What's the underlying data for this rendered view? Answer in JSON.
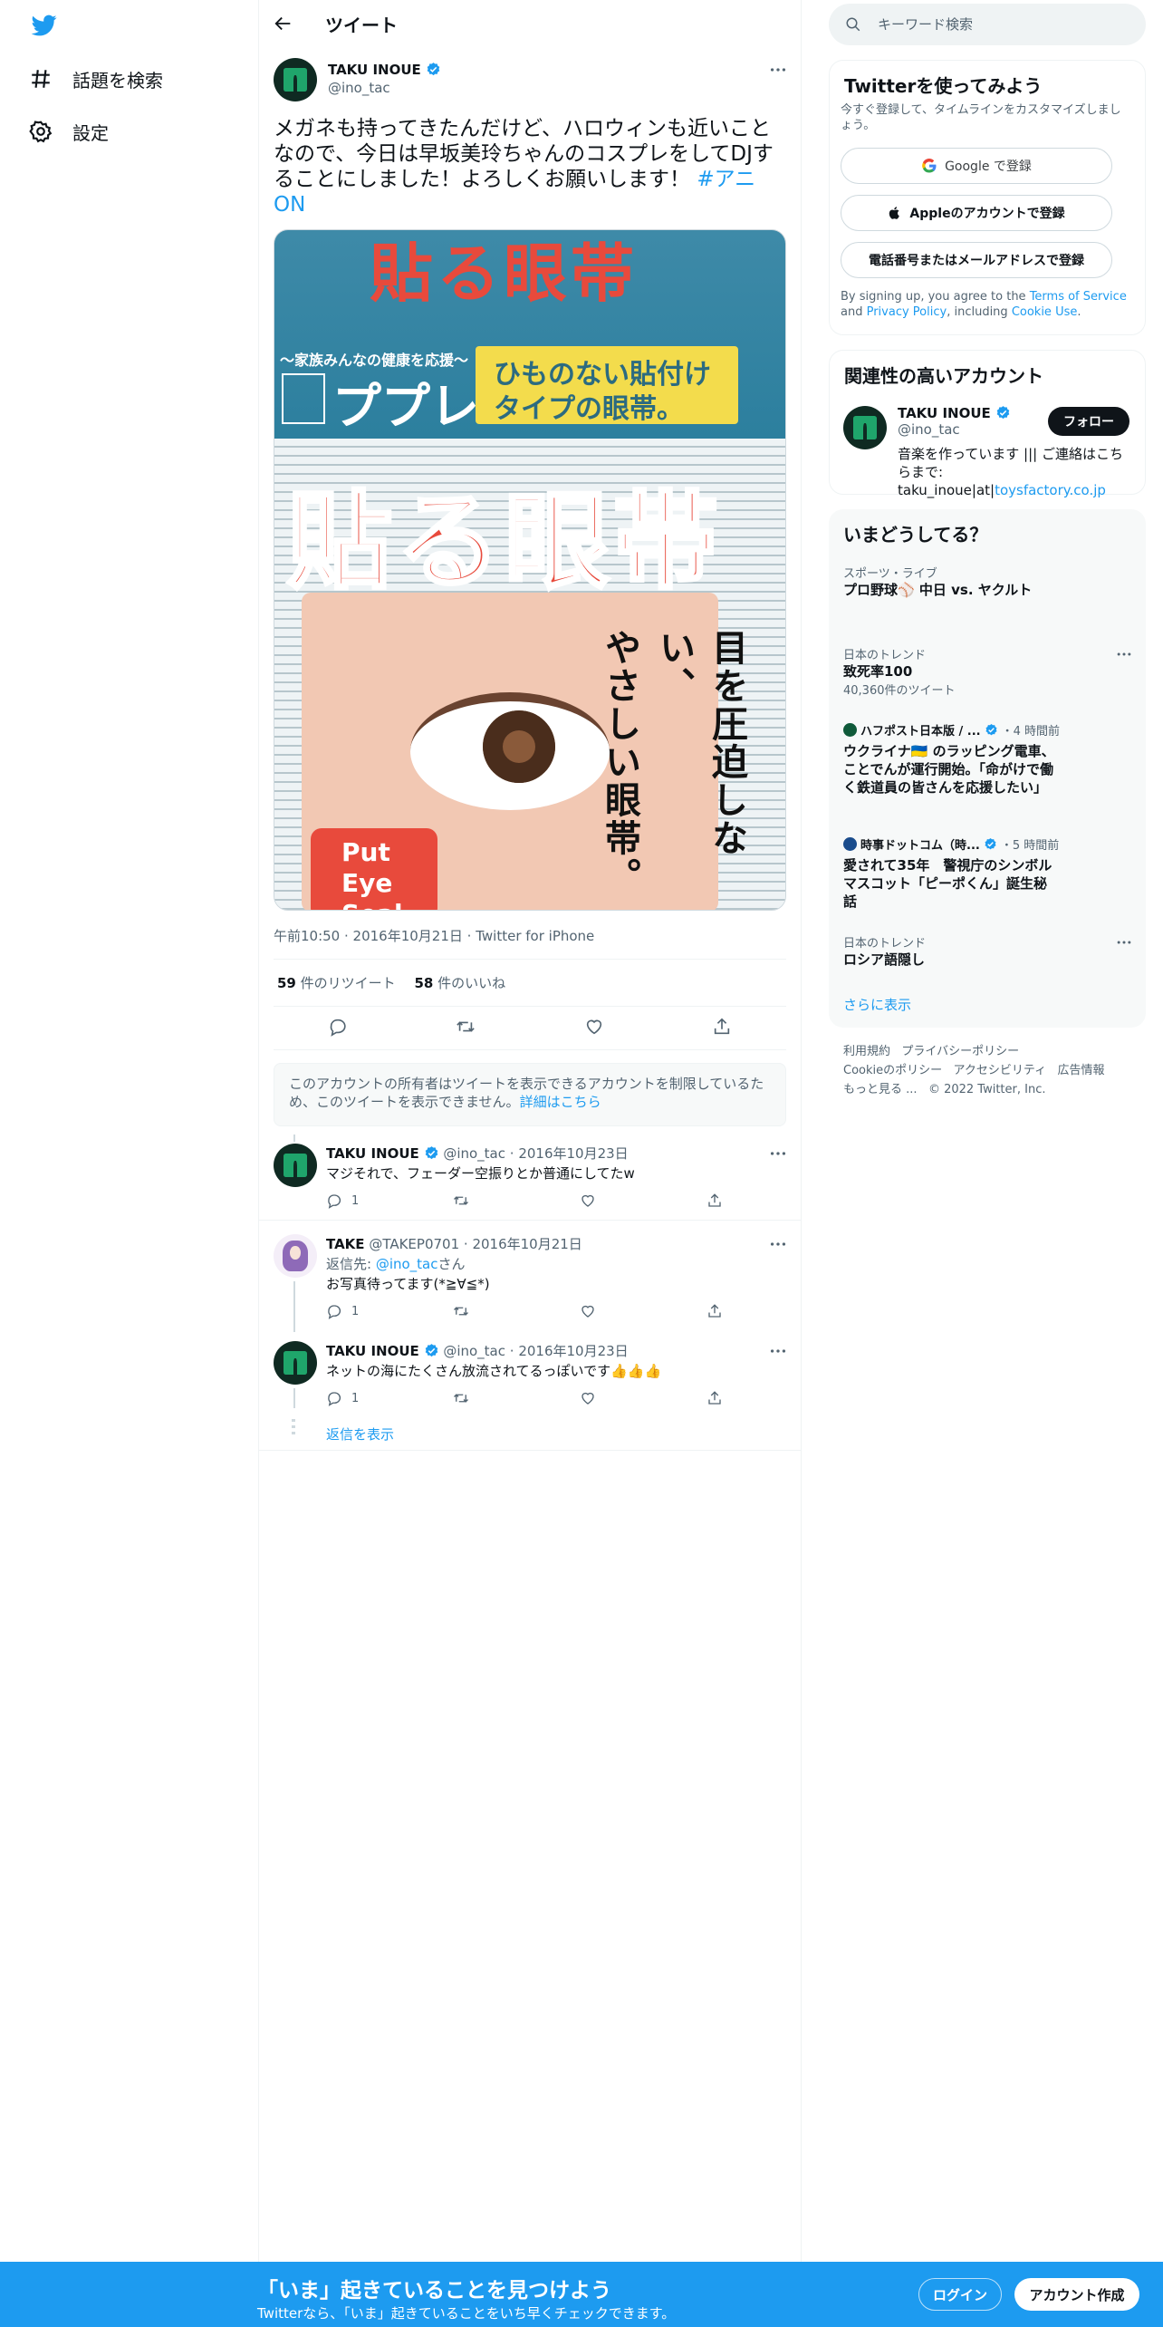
{
  "nav": {
    "logo": "twitter-bird-icon",
    "items": [
      {
        "label": "話題を検索",
        "icon": "hashtag-icon"
      },
      {
        "label": "設定",
        "icon": "gear-icon"
      }
    ]
  },
  "header": {
    "title": "ツイート"
  },
  "tweet": {
    "name": "TAKU INOUE",
    "handle": "@ino_tac",
    "text": "メガネも持ってきたんだけど、ハロウィンも近いことなので、今日は早坂美玲ちゃんのコスプレをしてDJすることにしました！よろしくお願いします！",
    "hashtag": "#アニON",
    "media": {
      "top_text": "貼る眼帯",
      "family_text": "〜家族みんなの健康を応援〜",
      "brand_text": "ププレ",
      "yellow_line1": "ひものない貼付け",
      "yellow_line2": "タイプの眼帯。",
      "big_text": "貼る眼帯",
      "vert_text1": "目を圧迫しない、",
      "vert_text2": "やさしい眼帯。",
      "put_text": "Put Eye Seal"
    },
    "time": "午前10:50",
    "date": "2016年10月21日",
    "source": "Twitter for iPhone",
    "retweets": "59",
    "retweets_label": "件のリツイート",
    "likes": "58",
    "likes_label": "件のいいね"
  },
  "notice": {
    "text": "このアカウントの所有者はツイートを表示できるアカウントを制限しているため、このツイートを表示できません。",
    "link": "詳細はこちら"
  },
  "replies": [
    {
      "name": "TAKU INOUE",
      "handle": "@ino_tac",
      "date": "2016年10月23日",
      "text": "マジそれで、フェーダー空振りとか普通にしてたw",
      "reply_count": "1"
    },
    {
      "name": "TAKE",
      "handle": "@TAKEP0701",
      "date": "2016年10月21日",
      "replying_prefix": "返信先: ",
      "replying_to": "@ino_tac",
      "replying_suffix": "さん",
      "text": "お写真待ってます(*≧∀≦*)",
      "reply_count": "1"
    },
    {
      "name": "TAKU INOUE",
      "handle": "@ino_tac",
      "date": "2016年10月23日",
      "text": "ネットの海にたくさん放流されてるっぽいです👍👍👍",
      "reply_count": "1"
    }
  ],
  "show_replies": "返信を表示",
  "search": {
    "placeholder": "キーワード検索"
  },
  "signup": {
    "title": "Twitterを使ってみよう",
    "subtitle": "今すぐ登録して、タイムラインをカスタマイズしましょう。",
    "google": "Google で登録",
    "apple": "Appleのアカウントで登録",
    "phone": "電話番号またはメールアドレスで登録",
    "legal_pre": "By signing up, you agree to the ",
    "terms": "Terms of Service",
    "and": " and ",
    "privacy": "Privacy Policy",
    "including": ", including ",
    "cookie": "Cookie Use",
    "period": "."
  },
  "related": {
    "title": "関連性の高いアカウント",
    "name": "TAKU INOUE",
    "handle": "@ino_tac",
    "bio": "音楽を作っています ||| ご連絡はこちらまで: taku_inoue|at|",
    "bio_link": "toysfactory.co.jp",
    "follow": "フォロー"
  },
  "trends": {
    "title": "いまどうしてる？",
    "items": [
      {
        "meta": "スポーツ・ライブ",
        "title": "プロ野球⚾ 中日 vs. ヤクルト"
      },
      {
        "meta": "日本のトレンド",
        "title": "致死率100",
        "count": "40,360件のツイート"
      },
      {
        "meta": "ハフポスト日本版 / ...",
        "time": "・4 時間前",
        "title": "ウクライナ🇺🇦 のラッピング電車、ことでんが運行開始。「命がけで働く鉄道員の皆さんを応援したい」"
      },
      {
        "meta": "時事ドットコム（時...",
        "time": "・5 時間前",
        "title": "愛されて35年　警視庁のシンボルマスコット「ピーポくん」誕生秘話"
      },
      {
        "meta": "日本のトレンド",
        "title": "ロシア語隠し"
      }
    ],
    "more": "さらに表示"
  },
  "footer": {
    "terms": "利用規約",
    "privacy": "プライバシーポリシー",
    "cookie": "Cookieのポリシー",
    "accessibility": "アクセシビリティ",
    "ads": "広告情報",
    "more": "もっと見る ...",
    "copyright": "© 2022 Twitter, Inc."
  },
  "bottom": {
    "headline": "「いま」起きていることを見つけよう",
    "sub": "Twitterなら、「いま」起きていることをいち早くチェックできます。",
    "login": "ログイン",
    "signup": "アカウント作成"
  },
  "colors": {
    "accent": "#1d9bf0",
    "text": "#0f1419",
    "muted": "#536471"
  }
}
